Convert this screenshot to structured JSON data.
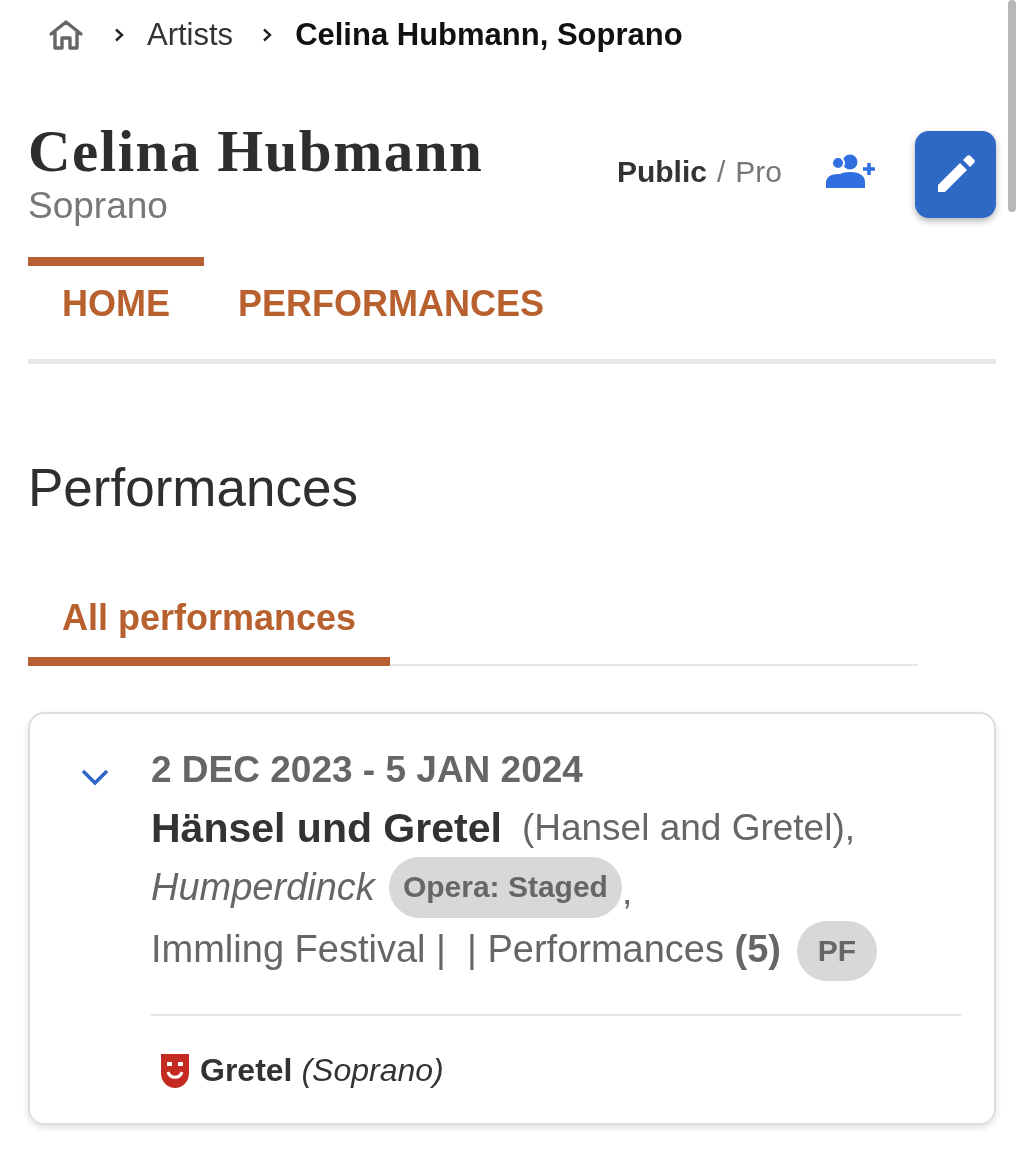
{
  "breadcrumb": [
    {
      "label": "Artists",
      "current": false
    },
    {
      "label": "Celina Hubmann, Soprano",
      "current": true
    }
  ],
  "artist": {
    "name": "Celina Hubmann",
    "voice": "Soprano"
  },
  "visibility": {
    "options": [
      {
        "label": "Public",
        "selected": true
      },
      {
        "label": "Pro",
        "selected": false
      }
    ],
    "separator": "/"
  },
  "tabs": [
    {
      "label": "HOME",
      "selected": true
    },
    {
      "label": "PERFORMANCES",
      "selected": false
    }
  ],
  "section": {
    "title": "Performances",
    "subtabs": [
      {
        "label": "All performances",
        "selected": true
      }
    ]
  },
  "performances": [
    {
      "expanded": true,
      "dates": "2 DEC 2023 - 5 JAN 2024",
      "title": "Hänsel und Gretel",
      "translation": "(Hansel and Gretel),",
      "composer": "Humperdinck",
      "genre": "Opera: Staged",
      "genre_suffix": ",",
      "venue_line": "Immling Festival |  | Performances **(5)**",
      "badge": "PF",
      "roles": [
        {
          "text": "**Gretel** *(Soprano)*"
        }
      ]
    }
  ]
}
